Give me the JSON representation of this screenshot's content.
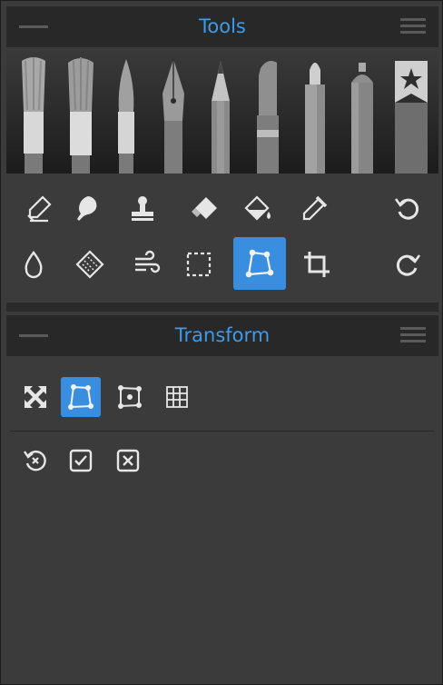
{
  "tools_panel": {
    "title": "Tools",
    "brushes": [
      "paint-brush",
      "flat-brush",
      "round-brush",
      "ink-pen",
      "pencil",
      "marker",
      "felt-pen",
      "airbrush",
      "favorites"
    ],
    "tools_row1": [
      "smudge",
      "blend",
      "stamp",
      "eraser",
      "fill",
      "eyedropper",
      "undo"
    ],
    "tools_row2": [
      "water",
      "texture",
      "blur",
      "selection",
      "transform",
      "crop",
      "redo"
    ],
    "active_tool": "transform"
  },
  "transform_panel": {
    "title": "Transform",
    "modes": [
      "free-transform",
      "perspective",
      "warp-point",
      "mesh-warp"
    ],
    "active_mode": "perspective",
    "actions": [
      "reset",
      "apply",
      "cancel"
    ]
  },
  "colors": {
    "accent": "#3a8ee0",
    "title": "#3d9be9",
    "icon": "#e6e6e6"
  }
}
